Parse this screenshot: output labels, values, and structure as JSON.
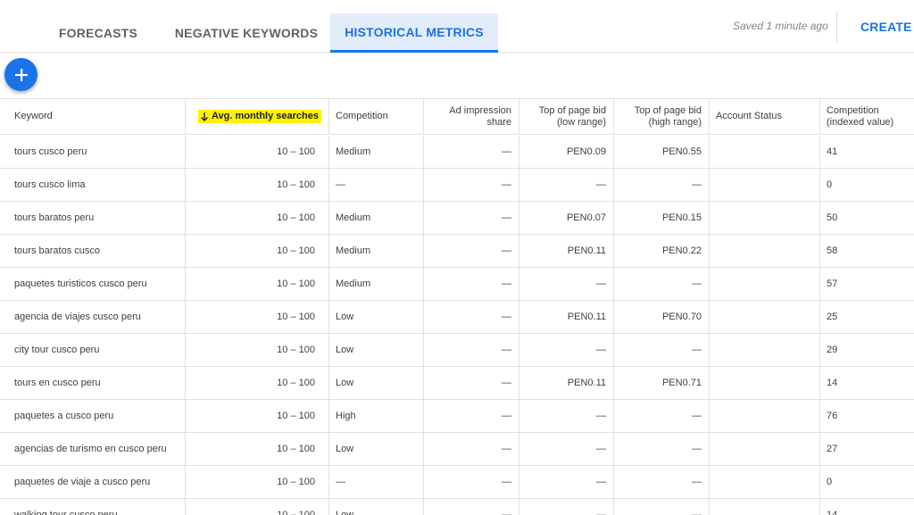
{
  "tabs": [
    {
      "label": "FORECASTS",
      "active": false
    },
    {
      "label": "NEGATIVE KEYWORDS",
      "active": false
    },
    {
      "label": "HISTORICAL METRICS",
      "active": true
    }
  ],
  "saved_status": "Saved 1 minute ago",
  "create_button": "CREATE CA",
  "fab_icon": "add-icon",
  "table": {
    "columns": [
      {
        "key": "keyword",
        "label": "Keyword"
      },
      {
        "key": "searches",
        "label": "Avg. monthly searches",
        "sorted": "descending"
      },
      {
        "key": "competition",
        "label": "Competition"
      },
      {
        "key": "impression",
        "label": "Ad impression share"
      },
      {
        "key": "low_bid",
        "label": "Top of page bid (low range)"
      },
      {
        "key": "high_bid",
        "label": "Top of page bid (high range)"
      },
      {
        "key": "account_status",
        "label": "Account Status"
      },
      {
        "key": "competition_index",
        "label": "Competition (indexed value)"
      }
    ],
    "header_lines": {
      "impression": [
        "Ad impression",
        "share"
      ],
      "low_bid": [
        "Top of page bid",
        "(low range)"
      ],
      "high_bid": [
        "Top of page bid",
        "(high range)"
      ],
      "competition_index": [
        "Competition",
        "(indexed value)"
      ]
    },
    "rows": [
      {
        "keyword": "tours cusco peru",
        "searches": "10 – 100",
        "competition": "Medium",
        "impression": "—",
        "low_bid": "PEN0.09",
        "high_bid": "PEN0.55",
        "account_status": "",
        "competition_index": "41"
      },
      {
        "keyword": "tours cusco lima",
        "searches": "10 – 100",
        "competition": "—",
        "impression": "—",
        "low_bid": "—",
        "high_bid": "—",
        "account_status": "",
        "competition_index": "0"
      },
      {
        "keyword": "tours baratos peru",
        "searches": "10 – 100",
        "competition": "Medium",
        "impression": "—",
        "low_bid": "PEN0.07",
        "high_bid": "PEN0.15",
        "account_status": "",
        "competition_index": "50"
      },
      {
        "keyword": "tours baratos cusco",
        "searches": "10 – 100",
        "competition": "Medium",
        "impression": "—",
        "low_bid": "PEN0.11",
        "high_bid": "PEN0.22",
        "account_status": "",
        "competition_index": "58"
      },
      {
        "keyword": "paquetes turisticos cusco peru",
        "searches": "10 – 100",
        "competition": "Medium",
        "impression": "—",
        "low_bid": "—",
        "high_bid": "—",
        "account_status": "",
        "competition_index": "57"
      },
      {
        "keyword": "agencia de viajes cusco peru",
        "searches": "10 – 100",
        "competition": "Low",
        "impression": "—",
        "low_bid": "PEN0.11",
        "high_bid": "PEN0.70",
        "account_status": "",
        "competition_index": "25"
      },
      {
        "keyword": "city tour cusco peru",
        "searches": "10 – 100",
        "competition": "Low",
        "impression": "—",
        "low_bid": "—",
        "high_bid": "—",
        "account_status": "",
        "competition_index": "29"
      },
      {
        "keyword": "tours en cusco peru",
        "searches": "10 – 100",
        "competition": "Low",
        "impression": "—",
        "low_bid": "PEN0.11",
        "high_bid": "PEN0.71",
        "account_status": "",
        "competition_index": "14"
      },
      {
        "keyword": "paquetes a cusco peru",
        "searches": "10 – 100",
        "competition": "High",
        "impression": "—",
        "low_bid": "—",
        "high_bid": "—",
        "account_status": "",
        "competition_index": "76"
      },
      {
        "keyword": "agencias de turismo en cusco peru",
        "searches": "10 – 100",
        "competition": "Low",
        "impression": "—",
        "low_bid": "—",
        "high_bid": "—",
        "account_status": "",
        "competition_index": "27"
      },
      {
        "keyword": "paquetes de viaje a cusco peru",
        "searches": "10 – 100",
        "competition": "—",
        "impression": "—",
        "low_bid": "—",
        "high_bid": "—",
        "account_status": "",
        "competition_index": "0"
      },
      {
        "keyword": "walking tour cusco peru",
        "searches": "10 – 100",
        "competition": "Low",
        "impression": "—",
        "low_bid": "—",
        "high_bid": "—",
        "account_status": "",
        "competition_index": "14"
      }
    ]
  },
  "colors": {
    "accent": "#1a73e8",
    "active_tab_bg": "#e3ecfb",
    "sort_highlight": "#fff200"
  }
}
